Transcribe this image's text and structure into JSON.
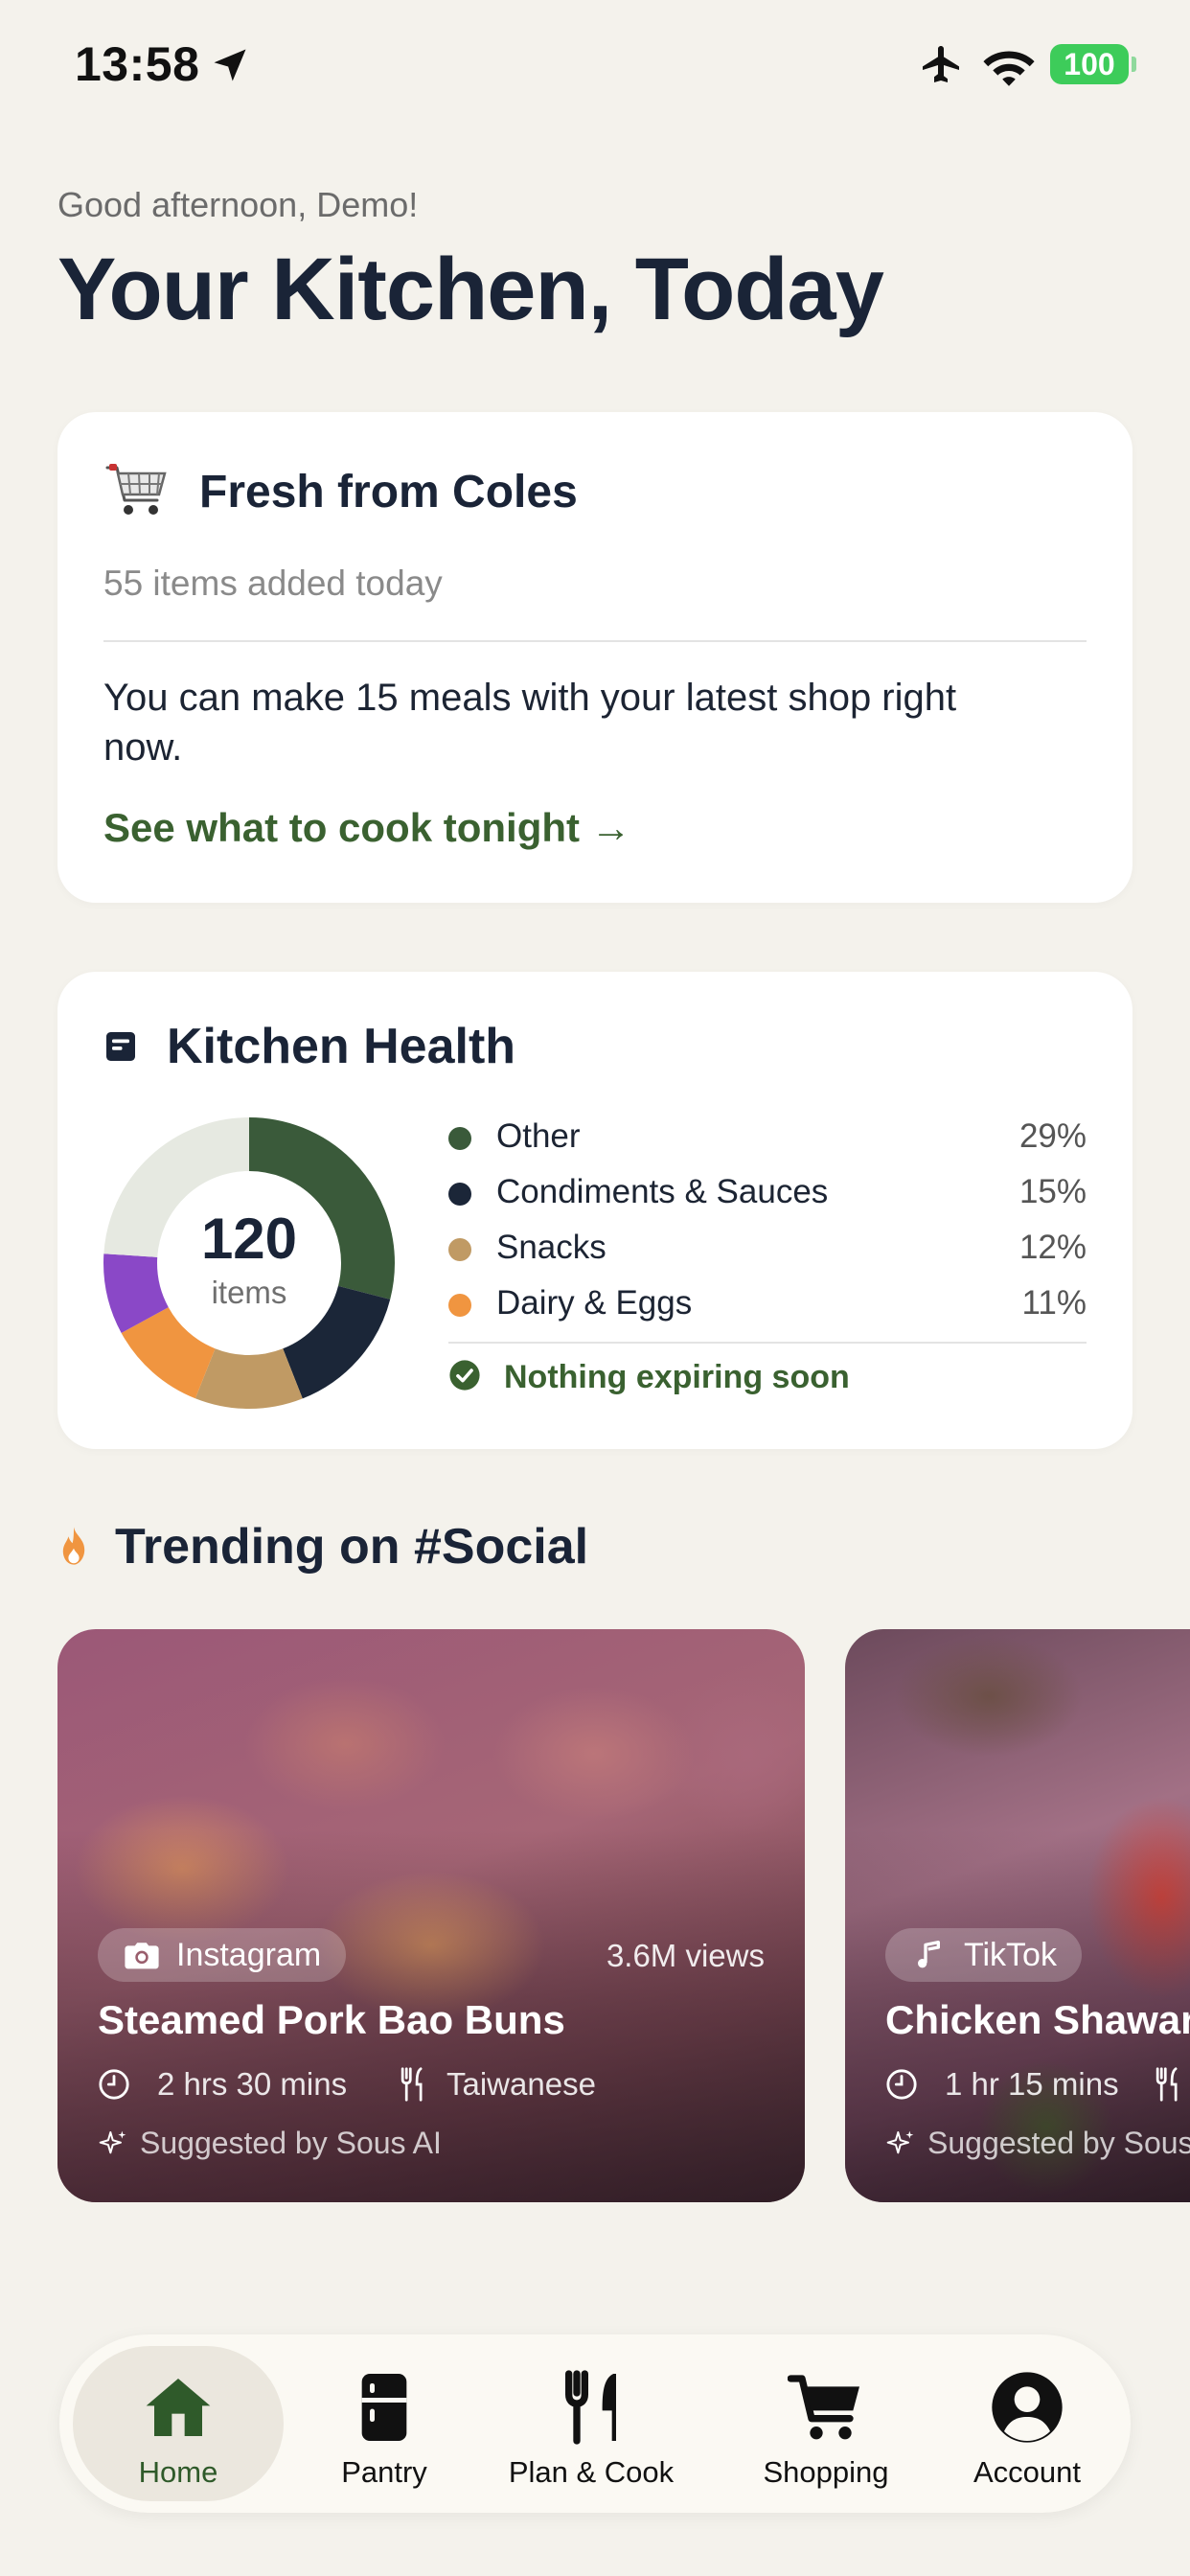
{
  "status_bar": {
    "time": "13:58",
    "battery": "100"
  },
  "header": {
    "greeting": "Good afternoon, Demo!",
    "title": "Your Kitchen, Today"
  },
  "coles_card": {
    "icon": "shopping-cart-icon",
    "title": "Fresh from Coles",
    "subtitle": "55 items added today",
    "body": "You can make 15 meals with your latest shop right now.",
    "link": "See what to cook tonight →"
  },
  "kitchen_health": {
    "title": "Kitchen Health",
    "count": "120",
    "unit": "items",
    "categories": [
      {
        "label": "Other",
        "percent": "29%",
        "value": 29,
        "color": "#3a5a3a"
      },
      {
        "label": "Condiments & Sauces",
        "percent": "15%",
        "value": 15,
        "color": "#1b2638"
      },
      {
        "label": "Snacks",
        "percent": "12%",
        "value": 12,
        "color": "#c09a64"
      },
      {
        "label": "Dairy & Eggs",
        "percent": "11%",
        "value": 11,
        "color": "#f09540"
      }
    ],
    "unlisted_segments": [
      {
        "value": 9,
        "color": "#8a48c7"
      },
      {
        "value": 24,
        "color": "#e6e9e1"
      }
    ],
    "expiry_status": "Nothing expiring soon"
  },
  "trending": {
    "title": "Trending on #Social",
    "recipes": [
      {
        "source": "Instagram",
        "source_icon": "camera-icon",
        "views": "3.6M views",
        "title": "Steamed Pork Bao Buns",
        "time": "2 hrs 30 mins",
        "cuisine": "Taiwanese",
        "suggested": "Suggested by Sous AI"
      },
      {
        "source": "TikTok",
        "source_icon": "music-note-icon",
        "title": "Chicken Shawarma",
        "time": "1 hr 15 mins",
        "suggested": "Suggested by Sous AI"
      }
    ]
  },
  "nav": {
    "items": [
      {
        "label": "Home",
        "icon": "home-icon",
        "active": true
      },
      {
        "label": "Pantry",
        "icon": "fridge-icon"
      },
      {
        "label": "Plan & Cook",
        "icon": "fork-knife-icon"
      },
      {
        "label": "Shopping",
        "icon": "cart-icon"
      },
      {
        "label": "Account",
        "icon": "account-icon"
      }
    ]
  },
  "colors": {
    "accent_green": "#3a6130",
    "background": "#f4f2ec",
    "heading": "#1a2437",
    "flame": "#f09540"
  }
}
